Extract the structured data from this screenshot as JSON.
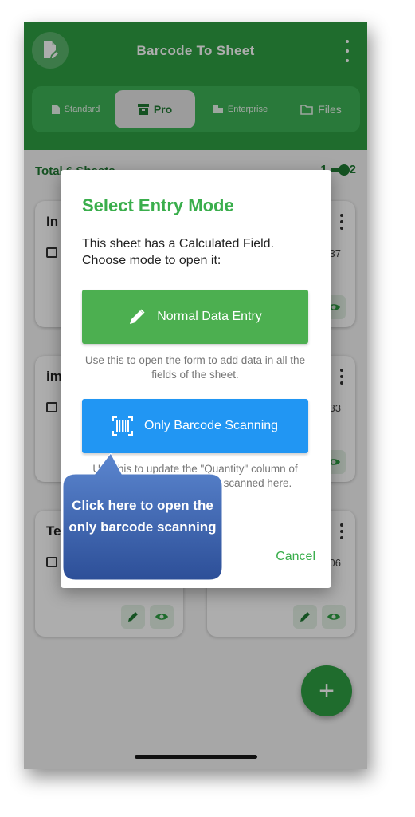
{
  "app": {
    "title": "Barcode To Sheet",
    "app_icon": "document-edit-icon",
    "menu_icon": "more-vert-icon"
  },
  "tabs": [
    {
      "label": "Standard",
      "icon": "description-icon",
      "active": false
    },
    {
      "label": "Pro",
      "icon": "archive-icon",
      "active": true
    },
    {
      "label": "Enterprise",
      "icon": "business-icon",
      "active": false
    },
    {
      "label": "Files",
      "icon": "folder-icon",
      "active": false
    }
  ],
  "summary": {
    "total": "Total 6 Sheets",
    "toggle_left": "1",
    "toggle_right": "2"
  },
  "cards": [
    {
      "title": "In",
      "code": "37"
    },
    {
      "title": "",
      "code": ""
    },
    {
      "title": "im",
      "code": "33"
    },
    {
      "title": "",
      "code": ""
    },
    {
      "title": "Te",
      "code": "06"
    },
    {
      "title": "",
      "code": ""
    }
  ],
  "dialog": {
    "title": "Select Entry Mode",
    "message": "This sheet has a Calculated Field. Choose mode to open it:",
    "normal_button": {
      "label": "Normal Data Entry",
      "icon": "pencil-icon"
    },
    "normal_hint": "Use this to open the form to add data in all the fields of the sheet.",
    "scan_button": {
      "label": "Only Barcode Scanning",
      "icon": "barcode-scan-icon"
    },
    "scan_hint": "Use this to update the \"Quantity\" column of already existing barcodes scanned here.",
    "cancel_label": "Cancel"
  },
  "callout": {
    "text": "Click here to open the only barcode scanning"
  },
  "colors": {
    "primary_green": "#2e9f43",
    "title_green": "#3aae4c",
    "button_green": "#4caf50",
    "button_blue": "#2196f3",
    "callout_blue": "#3a64b4"
  }
}
